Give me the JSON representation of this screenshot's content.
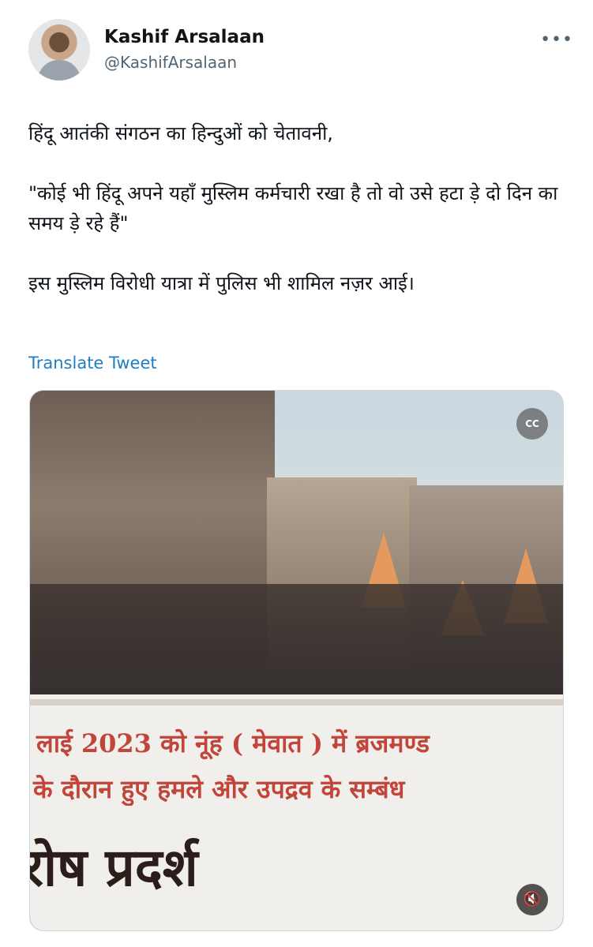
{
  "tweet": {
    "author": {
      "name": "Kashif Arsalaan",
      "handle": "@KashifArsalaan"
    },
    "more_icon": "more-horizontal-icon",
    "more_label": "•••",
    "text": "हिंदू आतंकी संगठन का हिन्दुओं को चेतावनी,\n\n\"कोई भी हिंदू अपने यहाँ मुस्लिम कर्मचारी रखा है तो वो उसे हटा ड़े दो दिन का समय ड़े रहे हैं\"\n\nइस मुस्लिम विरोधी यात्रा में पुलिस भी शामिल नज़र आई।",
    "translate_label": "Translate Tweet",
    "link_color": "#1d7fc4"
  },
  "media": {
    "type": "video",
    "banner_text": [
      "लाई 2023 को नूंह ( मेवात ) में ब्रजमण्ड",
      "के दौरान हुए हमले और उपद्रव के सम्बंध",
      "रोष प्रदर्श"
    ],
    "cc_icon": "closed-captions-off-icon",
    "cc_label": "CC",
    "mute_icon": "volume-muted-icon",
    "mute_label": "🔇"
  }
}
